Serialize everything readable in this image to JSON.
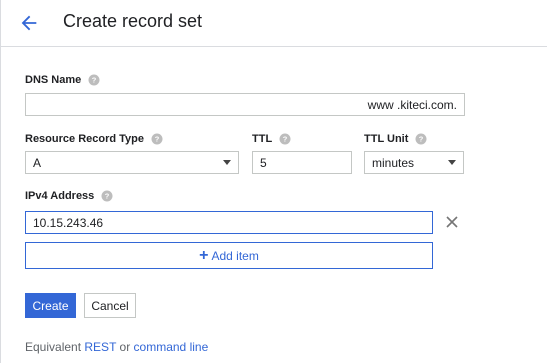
{
  "header": {
    "title": "Create record set"
  },
  "form": {
    "dns_name": {
      "label": "DNS Name",
      "value": "",
      "suffix": "www .kiteci.com."
    },
    "resource_record_type": {
      "label": "Resource Record Type",
      "value": "A"
    },
    "ttl": {
      "label": "TTL",
      "value": "5"
    },
    "ttl_unit": {
      "label": "TTL Unit",
      "value": "minutes"
    },
    "ipv4": {
      "label": "IPv4 Address",
      "value": "10.15.243.46"
    },
    "add_item_label": "Add item"
  },
  "actions": {
    "create_label": "Create",
    "cancel_label": "Cancel"
  },
  "footer": {
    "prefix": "Equivalent",
    "rest_label": "REST",
    "or_text": "or",
    "command_line_label": "command line"
  },
  "colors": {
    "accent": "#3367d6",
    "border": "#c4c7c5"
  },
  "icons": {
    "back": "arrow-left",
    "help": "question-circle",
    "remove": "close-x",
    "add": "plus"
  }
}
